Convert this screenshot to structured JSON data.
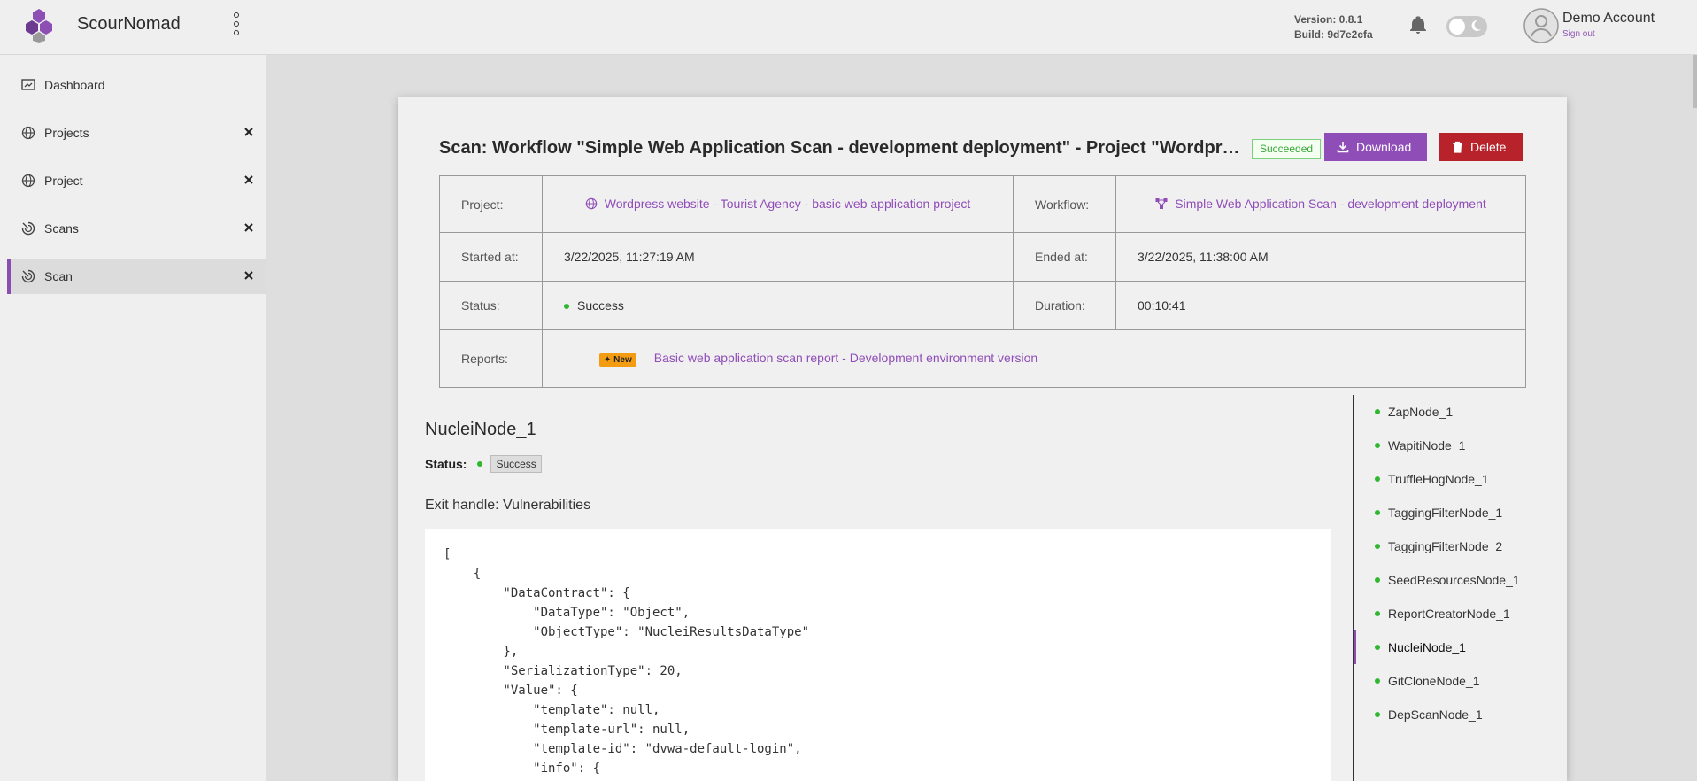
{
  "app": {
    "name": "ScourNomad"
  },
  "header": {
    "version": "Version: 0.8.1",
    "build": "Build: 9d7e2cfa",
    "user_name": "Demo Account",
    "sign_out": "Sign out"
  },
  "sidebar": {
    "items": [
      {
        "label": "Dashboard",
        "icon": "dashboard-icon",
        "closable": false,
        "active": false
      },
      {
        "label": "Projects",
        "icon": "globe-icon",
        "closable": true,
        "active": false
      },
      {
        "label": "Project",
        "icon": "globe-icon",
        "closable": true,
        "active": false
      },
      {
        "label": "Scans",
        "icon": "scan-icon",
        "closable": true,
        "active": false
      },
      {
        "label": "Scan",
        "icon": "scan-icon",
        "closable": true,
        "active": true
      }
    ]
  },
  "scan": {
    "title": "Scan: Workflow \"Simple Web Application Scan - development deployment\" - Project \"Wordpress website - Tourist Agency - basic web application project\"",
    "status_badge": "Succeeded",
    "download_label": "Download",
    "delete_label": "Delete",
    "info": {
      "project_label": "Project:",
      "project_value": "Wordpress website - Tourist Agency - basic web application project",
      "workflow_label": "Workflow:",
      "workflow_value": "Simple Web Application Scan - development deployment",
      "started_label": "Started at:",
      "started_value": "3/22/2025, 11:27:19 AM",
      "ended_label": "Ended at:",
      "ended_value": "3/22/2025, 11:38:00 AM",
      "status_label": "Status:",
      "status_value": "Success",
      "duration_label": "Duration:",
      "duration_value": "00:10:41",
      "reports_label": "Reports:",
      "new_badge": "New",
      "report_link": "Basic web application scan report - Development environment version"
    }
  },
  "node": {
    "title": "NucleiNode_1",
    "status_label": "Status:",
    "status_value": "Success",
    "exit_handle": "Exit handle: Vulnerabilities",
    "code": "[\n    {\n        \"DataContract\": {\n            \"DataType\": \"Object\",\n            \"ObjectType\": \"NucleiResultsDataType\"\n        },\n        \"SerializationType\": 20,\n        \"Value\": {\n            \"template\": null,\n            \"template-url\": null,\n            \"template-id\": \"dvwa-default-login\",\n            \"info\": {"
  },
  "node_list": [
    "ZapNode_1",
    "WapitiNode_1",
    "TruffleHogNode_1",
    "TaggingFilterNode_1",
    "TaggingFilterNode_2",
    "SeedResourcesNode_1",
    "ReportCreatorNode_1",
    "NucleiNode_1",
    "GitCloneNode_1",
    "DepScanNode_1"
  ],
  "node_list_active": "NucleiNode_1",
  "colors": {
    "accent": "#8f4db8",
    "danger": "#b8232b",
    "success": "#2fb82f",
    "new_badge": "#f39c12"
  }
}
